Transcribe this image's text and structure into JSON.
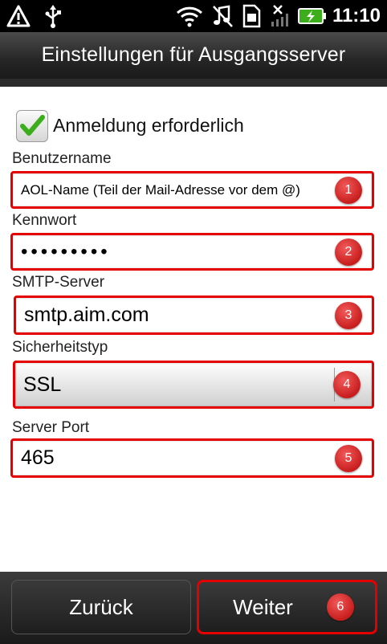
{
  "status_bar": {
    "icons": [
      "warning-icon",
      "usb-icon",
      "wifi-icon",
      "silent-icon",
      "sim-icon",
      "no-signal-icon",
      "battery-charging-icon"
    ],
    "time": "11:10"
  },
  "title": "Einstellungen für Ausgangsserver",
  "form": {
    "auth_required_label": "Anmeldung erforderlich",
    "auth_required_checked": true,
    "username": {
      "label": "Benutzername",
      "value": "AOL-Name (Teil der Mail-Adresse vor dem @)",
      "badge": "1"
    },
    "password": {
      "label": "Kennwort",
      "value": "•••••••••",
      "badge": "2"
    },
    "smtp_server": {
      "label": "SMTP-Server",
      "value": "smtp.aim.com",
      "badge": "3"
    },
    "security_type": {
      "label": "Sicherheitstyp",
      "value": "SSL",
      "badge": "4"
    },
    "server_port": {
      "label": "Server Port",
      "value": "465",
      "badge": "5"
    }
  },
  "buttons": {
    "back": "Zurück",
    "next": "Weiter",
    "next_badge": "6"
  },
  "colors": {
    "highlight": "#e40000",
    "check": "#3cae1c"
  }
}
